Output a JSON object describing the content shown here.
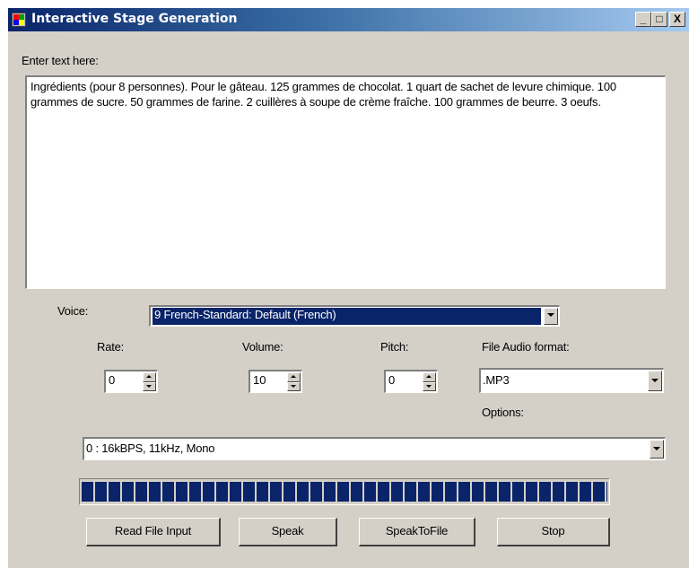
{
  "window": {
    "title": "Interactive Stage Generation",
    "minimize_glyph": "_",
    "maximize_glyph": "□",
    "close_glyph": "X"
  },
  "input": {
    "label": "Enter text here:",
    "text": "Ingrédients (pour 8 personnes). Pour le gâteau. 125 grammes de chocolat. 1 quart de sachet de levure chimique. 100 grammes de sucre. 50 grammes de farine. 2 cuillères à soupe de crème fraîche. 100 grammes de beurre. 3 oeufs."
  },
  "voice": {
    "label": "Voice:",
    "selected": "9 French-Standard: Default (French)"
  },
  "rate": {
    "label": "Rate:",
    "value": "0"
  },
  "volume": {
    "label": "Volume:",
    "value": "10"
  },
  "pitch": {
    "label": "Pitch:",
    "value": "0"
  },
  "audio_format": {
    "label": "File Audio format:",
    "selected": ".MP3"
  },
  "options": {
    "label": "Options:",
    "selected": "0 : 16kBPS, 11kHz, Mono"
  },
  "progress": {
    "value": 1.0
  },
  "buttons": {
    "read_file": "Read File Input",
    "speak": "Speak",
    "speak_to_file": "SpeakToFile",
    "stop": "Stop"
  },
  "colors": {
    "face": "#d4d0c8",
    "selection": "#0a246a",
    "title_gradient_start": "#0a246a",
    "title_gradient_end": "#a6caf0"
  },
  "icons": [
    "app-icon",
    "minimize-icon",
    "maximize-icon",
    "close-icon",
    "chevron-down-icon",
    "spin-up-icon",
    "spin-down-icon"
  ]
}
